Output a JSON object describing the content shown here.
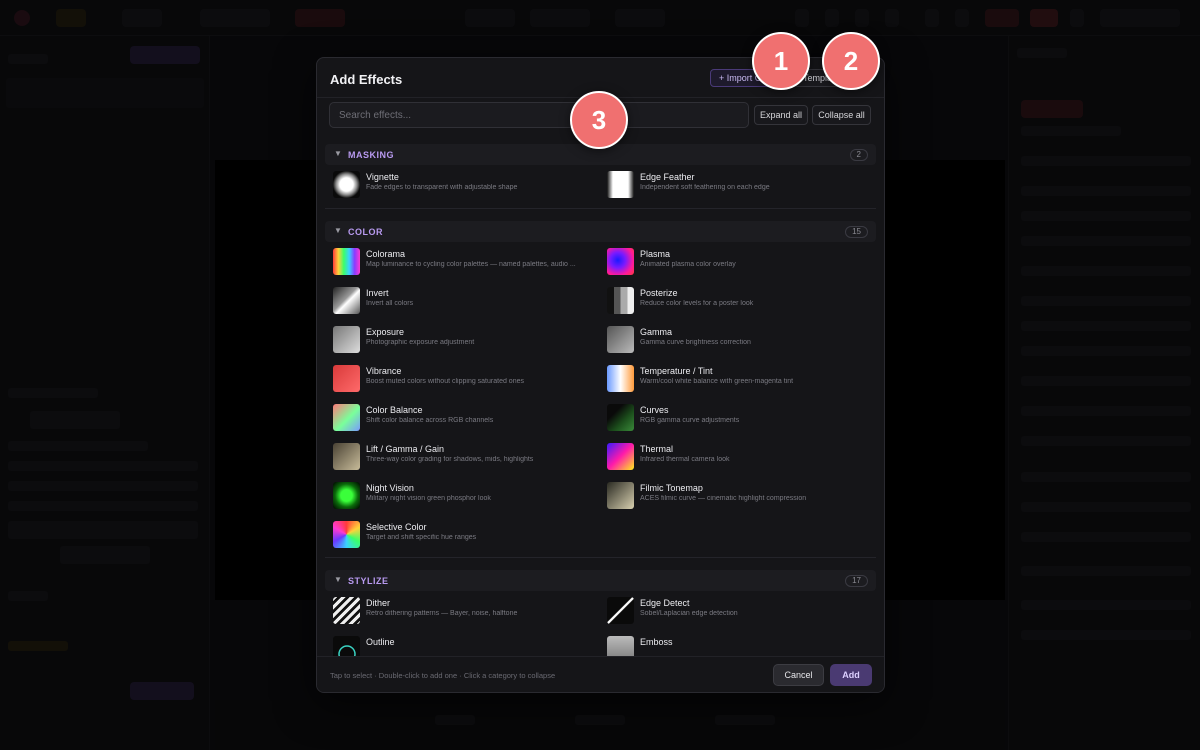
{
  "modal": {
    "title": "Add Effects",
    "import_label": "+ Import C",
    "template_label": "Templa",
    "search_placeholder": "Search effects...",
    "expand_all": "Expand all",
    "collapse_all": "Collapse all",
    "categories": [
      {
        "label": "MASKING",
        "count": "2",
        "effects": [
          {
            "name": "Vignette",
            "desc": "Fade edges to transparent with adjustable shape",
            "icon": "vignette-icon"
          },
          {
            "name": "Edge Feather",
            "desc": "Independent soft feathering on each edge",
            "icon": "edge-feather-icon"
          }
        ]
      },
      {
        "label": "COLOR",
        "count": "15",
        "effects": [
          {
            "name": "Colorama",
            "desc": "Map luminance to cycling color palettes — named palettes, audio ...",
            "icon": "colorama-icon"
          },
          {
            "name": "Plasma",
            "desc": "Animated plasma color overlay",
            "icon": "plasma-icon"
          },
          {
            "name": "Invert",
            "desc": "Invert all colors",
            "icon": "invert-icon"
          },
          {
            "name": "Posterize",
            "desc": "Reduce color levels for a poster look",
            "icon": "posterize-icon"
          },
          {
            "name": "Exposure",
            "desc": "Photographic exposure adjustment",
            "icon": "exposure-icon"
          },
          {
            "name": "Gamma",
            "desc": "Gamma curve brightness correction",
            "icon": "gamma-icon"
          },
          {
            "name": "Vibrance",
            "desc": "Boost muted colors without clipping saturated ones",
            "icon": "vibrance-icon"
          },
          {
            "name": "Temperature / Tint",
            "desc": "Warm/cool white balance with green-magenta tint",
            "icon": "temperature-icon"
          },
          {
            "name": "Color Balance",
            "desc": "Shift color balance across RGB channels",
            "icon": "color-balance-icon"
          },
          {
            "name": "Curves",
            "desc": "RGB gamma curve adjustments",
            "icon": "curves-icon"
          },
          {
            "name": "Lift / Gamma / Gain",
            "desc": "Three-way color grading for shadows, mids, highlights",
            "icon": "lift-gamma-gain-icon"
          },
          {
            "name": "Thermal",
            "desc": "Infrared thermal camera look",
            "icon": "thermal-icon"
          },
          {
            "name": "Night Vision",
            "desc": "Military night vision green phosphor look",
            "icon": "night-vision-icon"
          },
          {
            "name": "Filmic Tonemap",
            "desc": "ACES filmic curve — cinematic highlight compression",
            "icon": "filmic-tonemap-icon"
          },
          {
            "name": "Selective Color",
            "desc": "Target and shift specific hue ranges",
            "icon": "selective-color-icon"
          }
        ]
      },
      {
        "label": "STYLIZE",
        "count": "17",
        "effects": [
          {
            "name": "Dither",
            "desc": "Retro dithering patterns — Bayer, noise, halftone",
            "icon": "dither-icon"
          },
          {
            "name": "Edge Detect",
            "desc": "Sobel/Laplacian edge detection",
            "icon": "edge-detect-icon"
          },
          {
            "name": "Outline",
            "desc": "",
            "icon": "outline-icon"
          },
          {
            "name": "Emboss",
            "desc": "",
            "icon": "emboss-icon"
          }
        ]
      }
    ],
    "footer_hint": "Tap to select · Double-click to add one · Click a category to collapse",
    "cancel_label": "Cancel",
    "add_label": "Add"
  },
  "badges": [
    "1",
    "2",
    "3"
  ],
  "colors": {
    "accent": "#b89af0",
    "badge": "#f07070",
    "add_button": "#4a3a72"
  }
}
